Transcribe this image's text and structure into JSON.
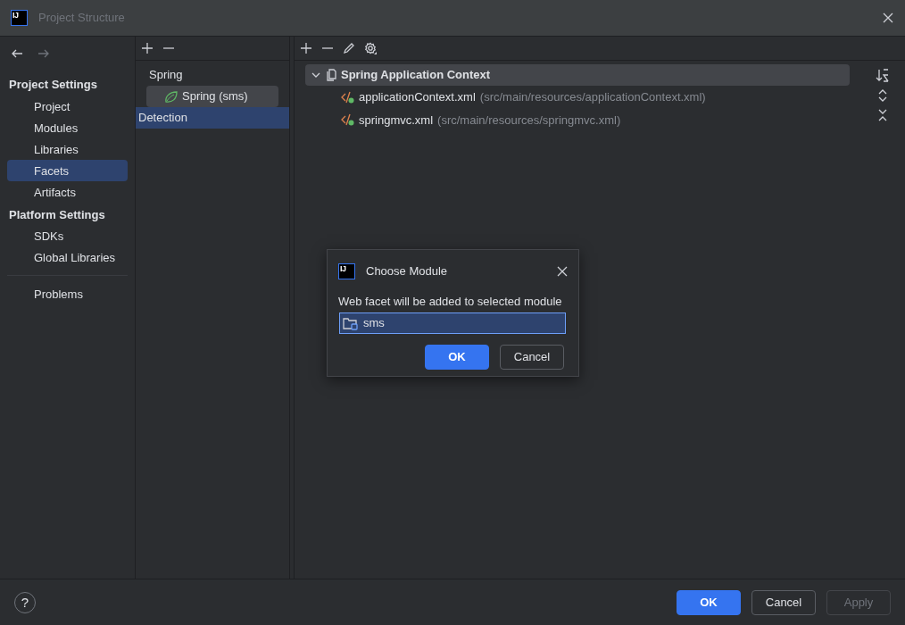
{
  "window": {
    "logo": "IJ",
    "title": "Project Structure",
    "active": false
  },
  "sidebar": {
    "sections": [
      {
        "heading": "Project Settings",
        "items": [
          {
            "label": "Project",
            "selected": false
          },
          {
            "label": "Modules",
            "selected": false
          },
          {
            "label": "Libraries",
            "selected": false
          },
          {
            "label": "Facets",
            "selected": true
          },
          {
            "label": "Artifacts",
            "selected": false
          }
        ]
      },
      {
        "heading": "Platform Settings",
        "items": [
          {
            "label": "SDKs",
            "selected": false
          },
          {
            "label": "Global Libraries",
            "selected": false
          }
        ]
      }
    ],
    "extra_items": [
      {
        "label": "Problems",
        "selected": false
      }
    ]
  },
  "facets": [
    {
      "label": "Spring",
      "kind": "group",
      "selected": false,
      "hovered": false,
      "children": [
        {
          "label": "Spring (sms)",
          "kind": "facet",
          "selected": false,
          "hovered": true
        }
      ]
    },
    {
      "label": "Detection",
      "kind": "item",
      "selected": true,
      "hovered": false
    }
  ],
  "context": {
    "title": "Spring Application Context",
    "expanded": true,
    "files": [
      {
        "name": "applicationContext.xml",
        "path": "(src/main/resources/applicationContext.xml)"
      },
      {
        "name": "springmvc.xml",
        "path": "(src/main/resources/springmvc.xml)"
      }
    ]
  },
  "dialog": {
    "logo": "IJ",
    "title": "Choose Module",
    "message": "Web facet will be added to selected module",
    "modules": [
      {
        "name": "sms",
        "selected": true
      }
    ],
    "buttons": [
      {
        "label": "OK",
        "kind": "primary",
        "disabled": false
      },
      {
        "label": "Cancel",
        "kind": "secondary",
        "disabled": false
      }
    ]
  },
  "footer": {
    "help": "?",
    "buttons": [
      {
        "label": "OK",
        "kind": "primary",
        "disabled": false
      },
      {
        "label": "Cancel",
        "kind": "secondary",
        "disabled": false
      },
      {
        "label": "Apply",
        "kind": "secondary",
        "disabled": true
      }
    ]
  }
}
